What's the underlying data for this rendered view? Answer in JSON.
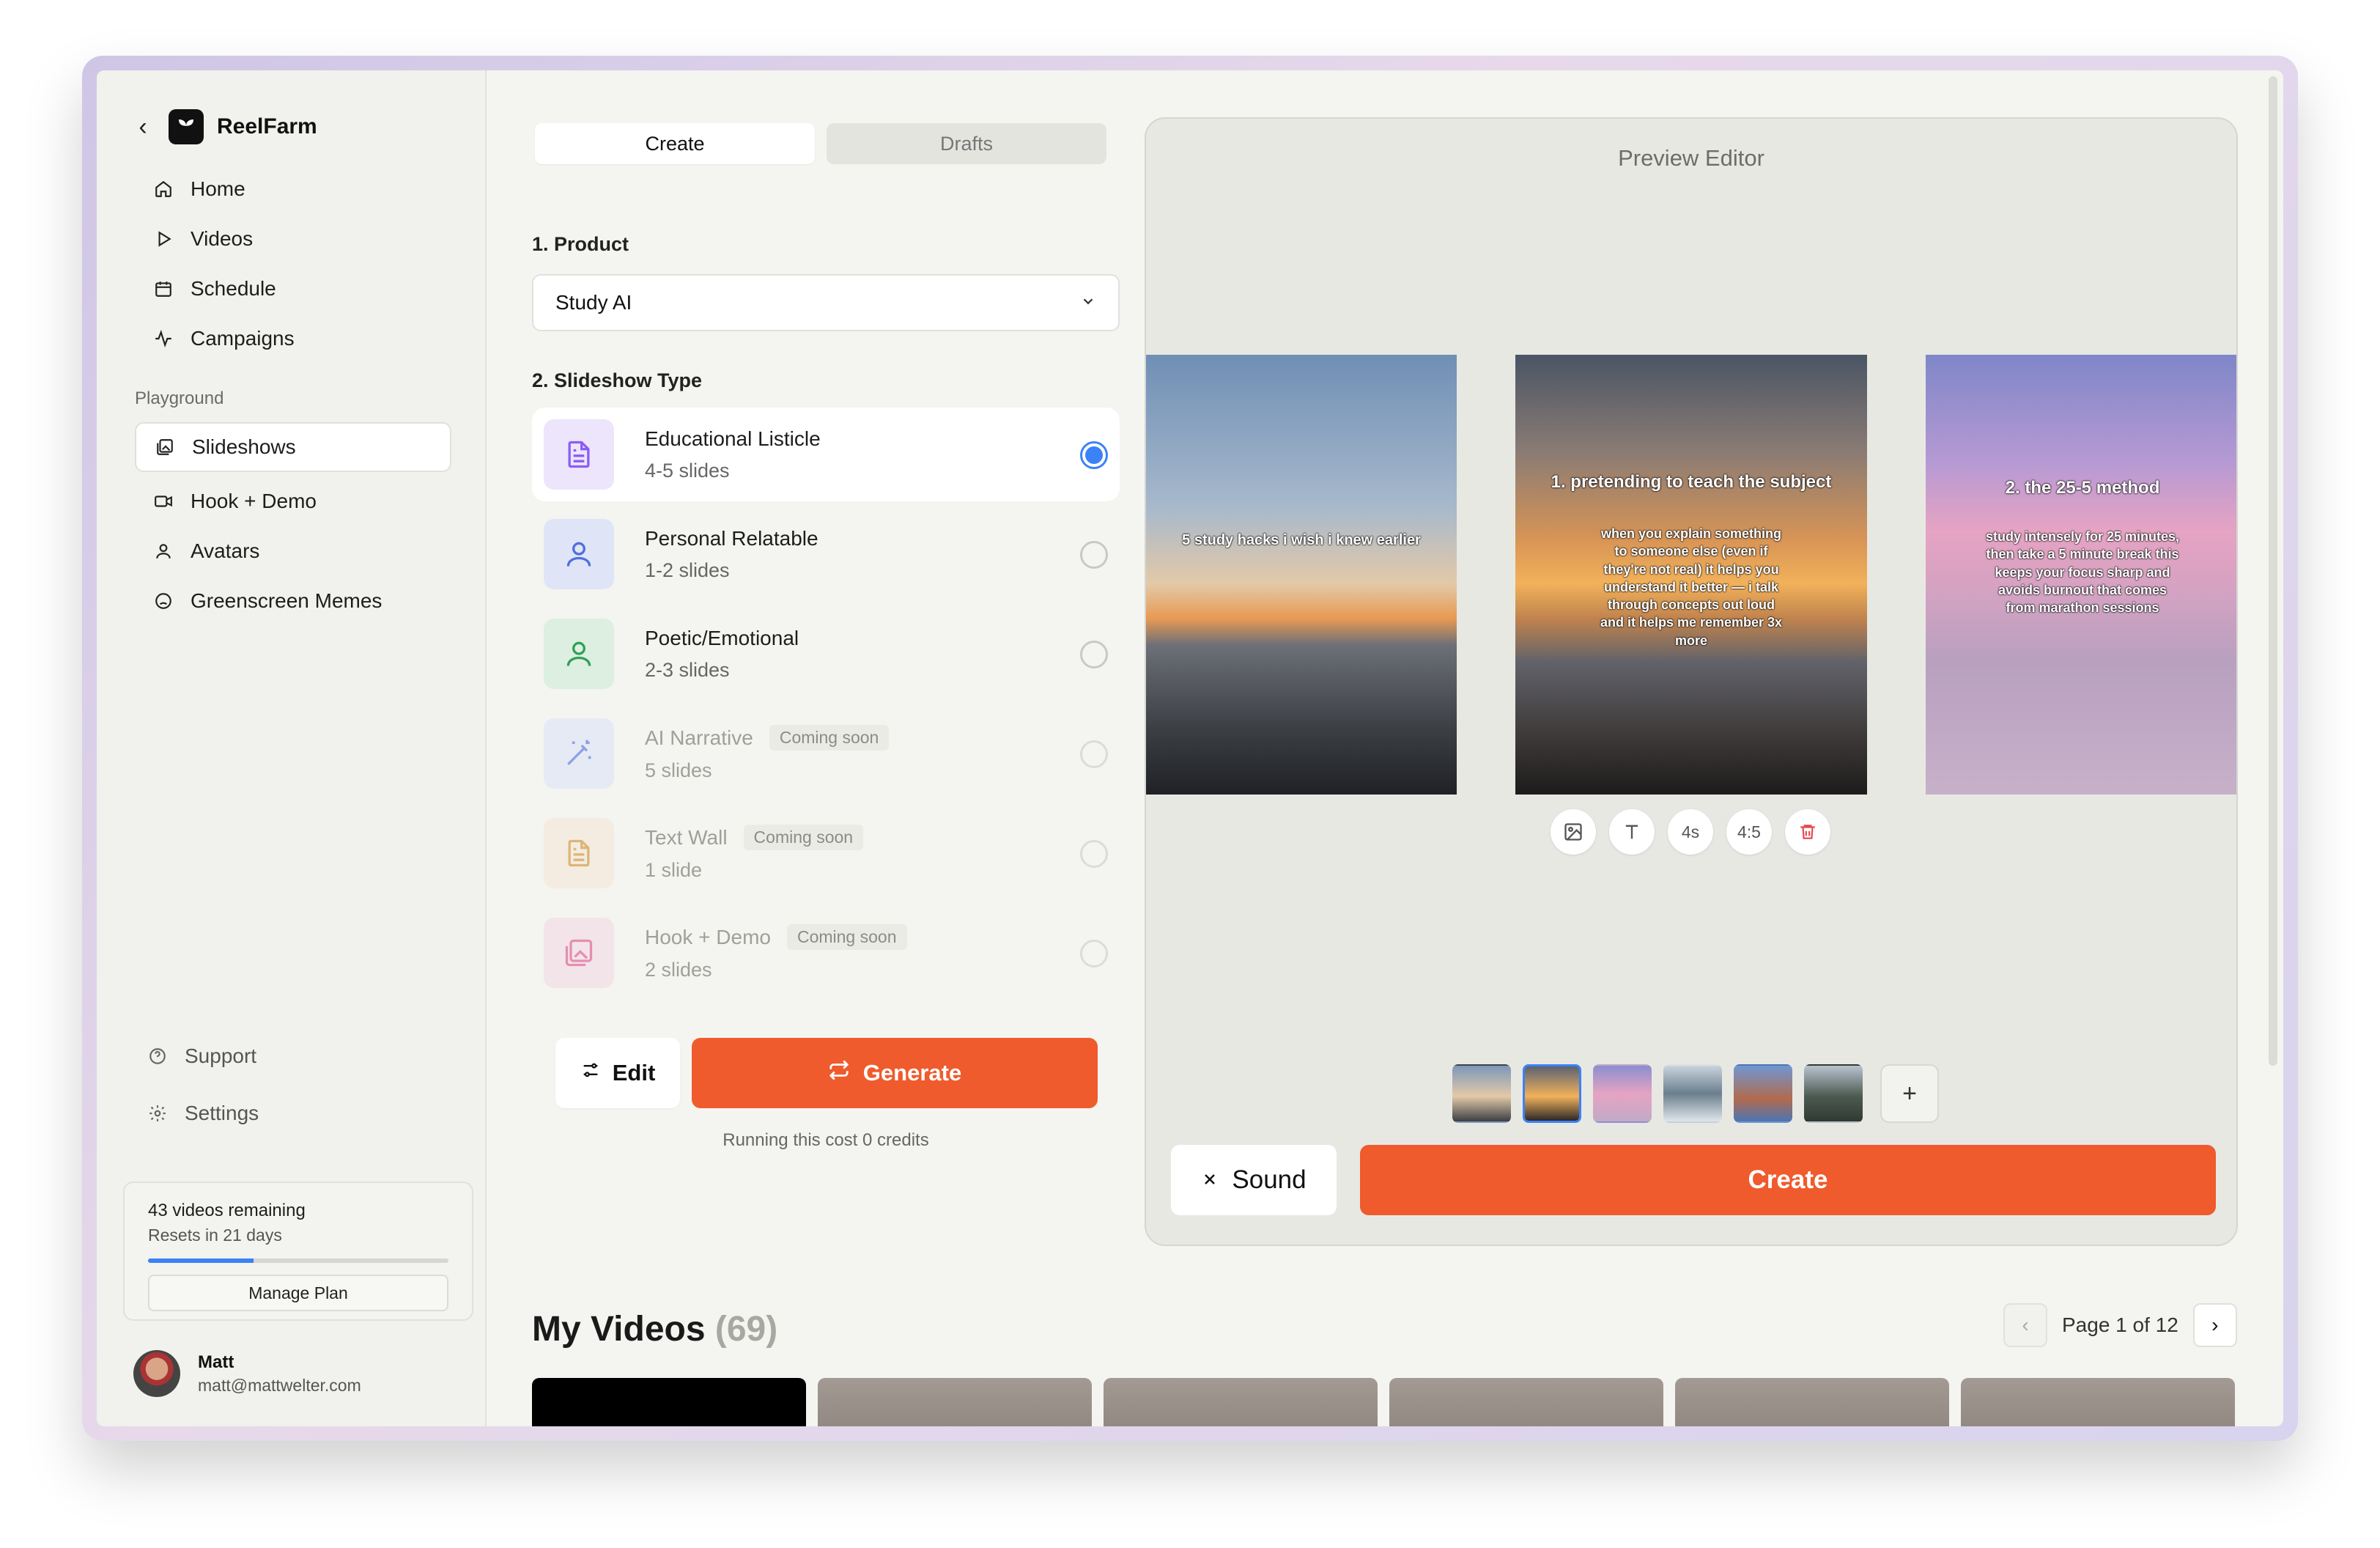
{
  "sidebar": {
    "brand": "ReelFarm",
    "nav": [
      {
        "label": "Home",
        "icon": "home-icon"
      },
      {
        "label": "Videos",
        "icon": "play-icon"
      },
      {
        "label": "Schedule",
        "icon": "calendar-icon"
      },
      {
        "label": "Campaigns",
        "icon": "activity-icon"
      }
    ],
    "section_label": "Playground",
    "playground": [
      {
        "label": "Slideshows",
        "icon": "images-icon",
        "active": true
      },
      {
        "label": "Hook + Demo",
        "icon": "video-camera-icon"
      },
      {
        "label": "Avatars",
        "icon": "user-icon"
      },
      {
        "label": "Greenscreen Memes",
        "icon": "face-icon"
      }
    ],
    "support": "Support",
    "settings": "Settings",
    "plan": {
      "remaining": "43 videos remaining",
      "resets": "Resets in 21 days",
      "progress": 0.35,
      "manage": "Manage Plan"
    },
    "user": {
      "name": "Matt",
      "email": "matt@mattwelter.com"
    }
  },
  "tabs": {
    "create": "Create",
    "drafts": "Drafts"
  },
  "product": {
    "label": "1. Product",
    "value": "Study AI"
  },
  "slideshow_type": {
    "label": "2. Slideshow Type",
    "coming_soon": "Coming soon",
    "items": [
      {
        "name": "Educational Listicle",
        "slides": "4-5 slides",
        "selected": true,
        "color": "#8b5cf6"
      },
      {
        "name": "Personal Relatable",
        "slides": "1-2 slides",
        "color": "#4f6fe0"
      },
      {
        "name": "Poetic/Emotional",
        "slides": "2-3 slides",
        "color": "#2fa05a"
      },
      {
        "name": "AI Narrative",
        "slides": "5 slides",
        "soon": true,
        "color": "#7b93e6"
      },
      {
        "name": "Text Wall",
        "slides": "1 slide",
        "soon": true,
        "color": "#d6a55e"
      },
      {
        "name": "Hook + Demo",
        "slides": "2 slides",
        "soon": true,
        "color": "#e07aa0"
      }
    ]
  },
  "actions": {
    "edit": "Edit",
    "generate": "Generate",
    "cost": "Running this cost 0 credits"
  },
  "preview": {
    "title": "Preview Editor",
    "slide1": "5 study hacks i wish i knew earlier",
    "slide2_title": "1. pretending to teach the subject",
    "slide2_body": "when you explain something to someone else (even if they're not real) it helps you understand it better — i talk through concepts out loud and it helps me remember 3x more",
    "slide3_title": "2. the 25-5 method",
    "slide3_body": "study intensely for 25 minutes, then take a 5 minute break this keeps your focus sharp and avoids burnout that comes from marathon sessions",
    "duration": "4s",
    "ratio": "4:5",
    "sound": "Sound",
    "create": "Create"
  },
  "my_videos": {
    "title": "My Videos",
    "count": "(69)",
    "page": "Page 1 of 12"
  },
  "colors": {
    "accent": "#ef5b2c",
    "selected": "#3b82f6"
  }
}
